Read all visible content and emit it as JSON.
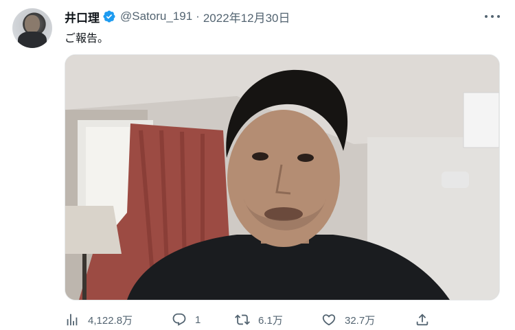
{
  "author": {
    "name": "井口理",
    "handle": "@Satoru_191",
    "separator": "·",
    "date": "2022年12月30日",
    "verified_icon": "verified-badge-icon",
    "avatar_icon": "avatar"
  },
  "tweet": {
    "text": "ご報告。",
    "media": "video-thumbnail"
  },
  "actions": {
    "views": "4,122.8万",
    "replies": "1",
    "retweets": "6.1万",
    "likes": "32.7万"
  },
  "icons": {
    "more": "more-icon",
    "views": "analytics-icon",
    "reply": "reply-icon",
    "retweet": "retweet-icon",
    "like": "heart-icon",
    "share": "share-icon"
  },
  "colors": {
    "text": "#0f1419",
    "secondary": "#536471",
    "verified": "#1d9bf0"
  }
}
